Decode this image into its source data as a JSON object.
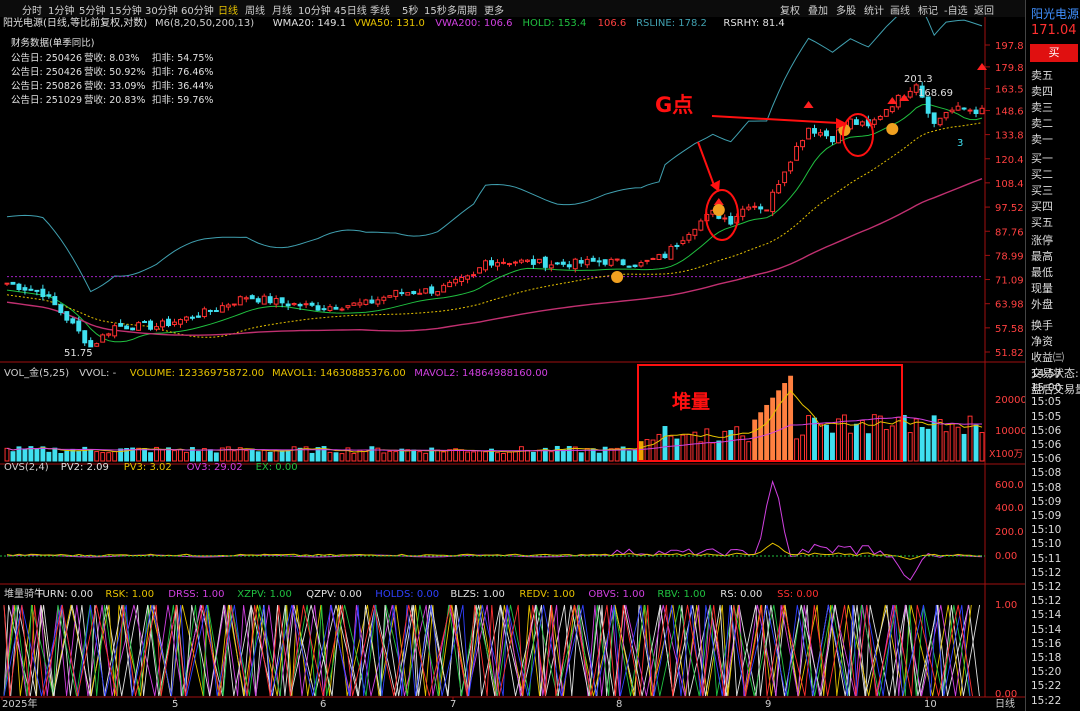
{
  "period_tabs": [
    "分时",
    "1分钟",
    "5分钟",
    "15分钟",
    "30分钟",
    "60分钟",
    "日线",
    "周线",
    "月线",
    "10分钟",
    "45日线",
    "季线",
    "5秒",
    "15秒",
    "多周期",
    "更多"
  ],
  "active_period": "日线",
  "right_menu": [
    "复权",
    "叠加",
    "多股",
    "统计",
    "画线",
    "标记",
    "-自选",
    "返回"
  ],
  "stock_title": "阳光电源(日线,等比前复权,对数)",
  "indicators": {
    "main": [
      {
        "text": "M6(8,20,50,200,13)",
        "color": "#d0d0d0"
      },
      {
        "text": "WMA20: 149.1",
        "color": "#e0e0e0"
      },
      {
        "text": "VWA50: 131.0",
        "color": "#e6c200"
      },
      {
        "text": "VWA200: 106.6",
        "color": "#d040e0"
      },
      {
        "text": "HOLD: 153.4",
        "color": "#20c040"
      },
      {
        "text": "106.6",
        "color": "#ff4040"
      },
      {
        "text": "RSLINE: 178.2",
        "color": "#40a0b0"
      },
      {
        "text": "RSRHY: 81.4",
        "color": "#e0e0e0"
      }
    ],
    "vol": [
      {
        "text": "VOL_金(5,25)",
        "color": "#d0d0d0"
      },
      {
        "text": "VVOL: -",
        "color": "#d0d0d0"
      },
      {
        "text": "VOLUME: 12336975872.00",
        "color": "#e6c200"
      },
      {
        "text": "MAVOL1: 14630885376.00",
        "color": "#e6c200"
      },
      {
        "text": "MAVOL2: 14864988160.00",
        "color": "#d040e0"
      }
    ],
    "ovs": [
      {
        "text": "OVS(2,4)",
        "color": "#d0d0d0"
      },
      {
        "text": "PV2: 2.09",
        "color": "#e0e0e0"
      },
      {
        "text": "PV3: 3.02",
        "color": "#e6c200"
      },
      {
        "text": "OV3: 29.02",
        "color": "#d040e0"
      },
      {
        "text": "EX: 0.00",
        "color": "#20c040"
      }
    ],
    "bull": [
      {
        "text": "堆量骑牛",
        "color": "#d0d0d0"
      },
      {
        "text": "TURN: 0.00",
        "color": "#e0e0e0"
      },
      {
        "text": "RSK: 1.00",
        "color": "#e6c200"
      },
      {
        "text": "DRSS: 1.00",
        "color": "#d040e0"
      },
      {
        "text": "XZPV: 1.00",
        "color": "#20c040"
      },
      {
        "text": "QZPV: 0.00",
        "color": "#e0e0e0"
      },
      {
        "text": "HOLDS: 0.00",
        "color": "#3040ff"
      },
      {
        "text": "BLZS: 1.00",
        "color": "#e0e0e0"
      },
      {
        "text": "REDV: 1.00",
        "color": "#e6c200"
      },
      {
        "text": "OBVS: 1.00",
        "color": "#d040e0"
      },
      {
        "text": "RBV: 1.00",
        "color": "#20c040"
      },
      {
        "text": "RS: 0.00",
        "color": "#e0e0e0"
      },
      {
        "text": "SS: 0.00",
        "color": "#ff3030"
      }
    ]
  },
  "financial": {
    "title": "财务数据(单季同比)",
    "rows": [
      {
        "date": "公告日: 250426",
        "rev": "营收: 8.03%",
        "net": "扣非: 54.75%"
      },
      {
        "date": "公告日: 250426",
        "rev": "营收: 50.92%",
        "net": "扣非: 76.46%"
      },
      {
        "date": "公告日: 250826",
        "rev": "营收: 33.09%",
        "net": "扣非: 36.44%"
      },
      {
        "date": "公告日: 251029",
        "rev": "营收: 20.83%",
        "net": "扣非: 59.76%"
      }
    ]
  },
  "annotations": {
    "g_point": "G点",
    "pile_volume": "堆量",
    "high_label": "201.3",
    "high_label2": "168.69",
    "low_label": "51.75",
    "mark_3": "3"
  },
  "price_axis": [
    "197.8",
    "179.8",
    "163.5",
    "148.6",
    "133.8",
    "120.4",
    "108.4",
    "97.52",
    "87.76",
    "78.99",
    "71.09",
    "63.98",
    "57.58",
    "51.82"
  ],
  "vol_axis": [
    "20000",
    "10000",
    "X100万"
  ],
  "ovs_axis": [
    "600.0",
    "400.0",
    "200.0",
    "0.00"
  ],
  "bull_axis": [
    "1.00",
    "0.00"
  ],
  "time_axis": [
    "2025年",
    "5",
    "6",
    "7",
    "8",
    "9",
    "10",
    "日线"
  ],
  "side_panel": {
    "name": "阳光电源",
    "price": "171.04",
    "buy_label": "买",
    "sell_levels": [
      "卖五",
      "卖四",
      "卖三",
      "卖二",
      "卖一"
    ],
    "buy_levels": [
      "买一",
      "买二",
      "买三",
      "买四",
      "买五"
    ],
    "stats": [
      "涨停",
      "最高",
      "最低",
      "现量",
      "外盘",
      "换手",
      "净资",
      "收益㈢",
      "交易状态:",
      "盘后交易量"
    ],
    "times": [
      "14:57",
      "15:00",
      "15:05",
      "15:05",
      "15:06",
      "15:06",
      "15:06",
      "15:08",
      "15:08",
      "15:09",
      "15:09",
      "15:10",
      "15:10",
      "15:11",
      "15:12",
      "15:12",
      "15:12",
      "15:14",
      "15:14",
      "15:16",
      "15:18",
      "15:20",
      "15:22",
      "15:22"
    ]
  },
  "colors": {
    "up": "#ff3030",
    "down": "#40e0f0",
    "ma20": "#40a0b0",
    "hold": "#20c040",
    "vwa50": "#e6c200",
    "vwa200": "#c03070",
    "volhl": "#ff8040",
    "frame": "#e01010"
  },
  "chart_data": {
    "type": "candlestick",
    "title": "阳光电源(日线,等比前复权,对数)",
    "price_scale": "log",
    "ylim": [
      51.82,
      197.8
    ],
    "x_month_labels": [
      "2025年",
      "5",
      "6",
      "7",
      "8",
      "9",
      "10"
    ],
    "bars": 164,
    "close_anchors": [
      [
        0,
        70
      ],
      [
        6,
        67
      ],
      [
        10,
        60
      ],
      [
        14,
        53
      ],
      [
        18,
        58
      ],
      [
        25,
        58
      ],
      [
        30,
        60
      ],
      [
        34,
        62
      ],
      [
        40,
        66
      ],
      [
        47,
        64
      ],
      [
        52,
        63
      ],
      [
        60,
        64
      ],
      [
        65,
        67
      ],
      [
        72,
        68
      ],
      [
        78,
        72
      ],
      [
        80,
        77
      ],
      [
        85,
        77
      ],
      [
        92,
        76
      ],
      [
        100,
        77
      ],
      [
        106,
        76
      ],
      [
        110,
        79
      ],
      [
        115,
        90
      ],
      [
        118,
        95
      ],
      [
        121,
        92
      ],
      [
        124,
        99
      ],
      [
        127,
        97
      ],
      [
        130,
        115
      ],
      [
        134,
        138
      ],
      [
        138,
        132
      ],
      [
        141,
        142
      ],
      [
        144,
        138
      ],
      [
        147,
        150
      ],
      [
        150,
        160
      ],
      [
        152,
        168
      ],
      [
        155,
        140
      ],
      [
        157,
        148
      ],
      [
        160,
        150
      ],
      [
        163,
        148
      ]
    ],
    "annotated_high": 201.3,
    "annotated_low": 51.75
  }
}
